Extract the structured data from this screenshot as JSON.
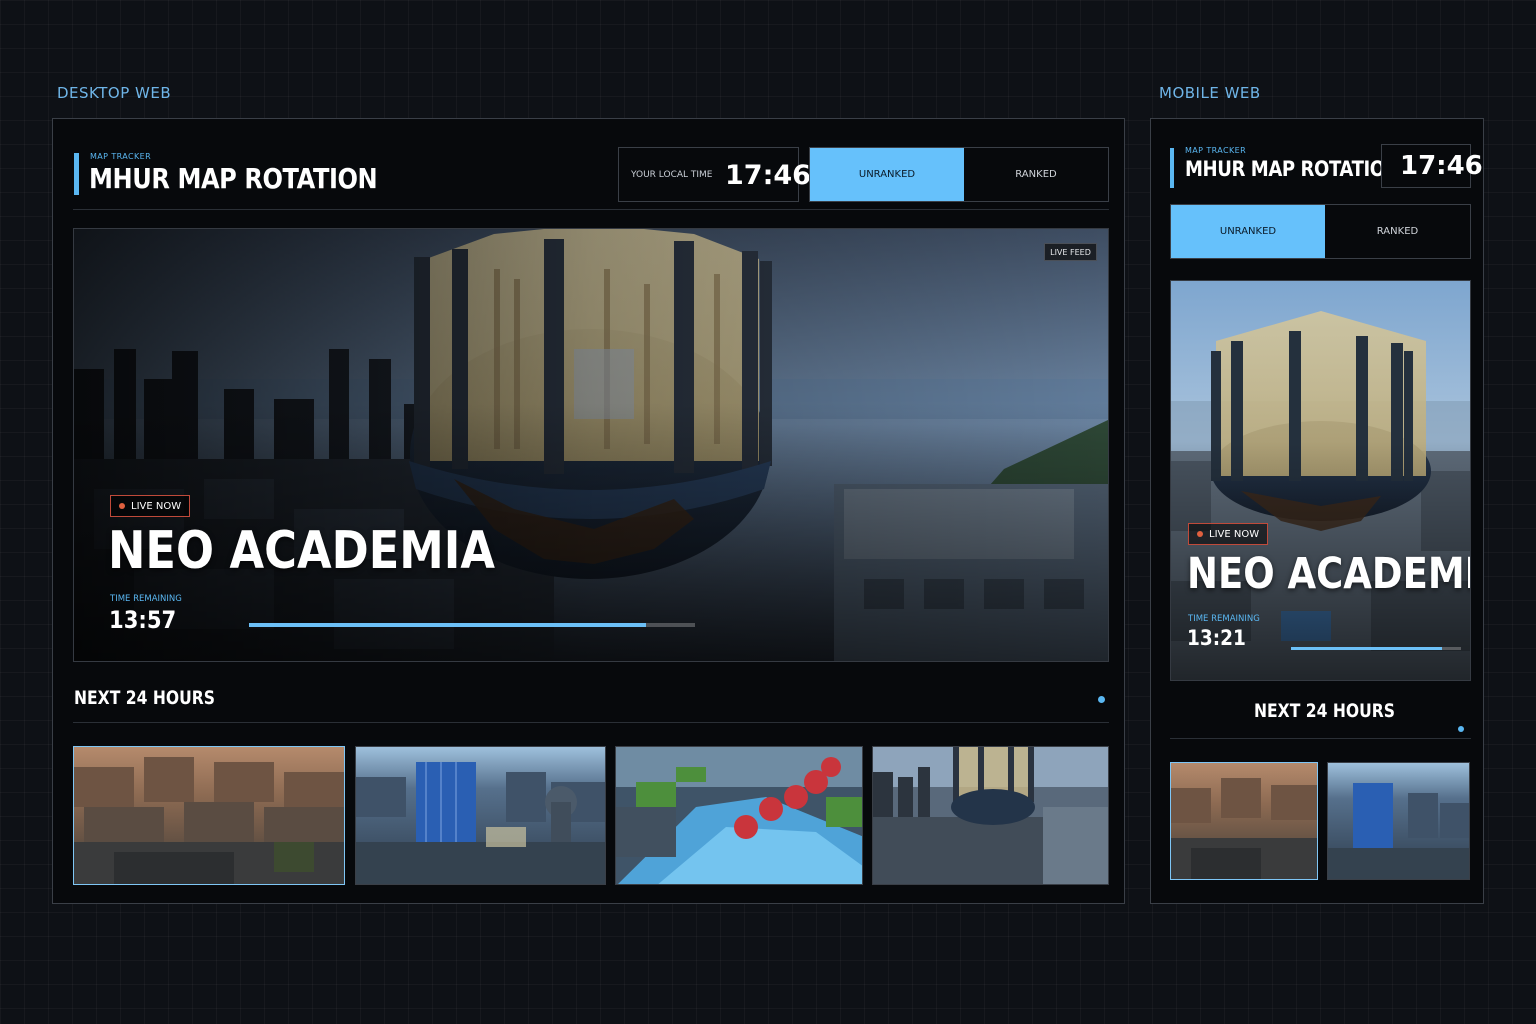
{
  "captions": {
    "desktop": "DESKTOP WEB",
    "mobile": "MOBILE WEB"
  },
  "desktop": {
    "header": {
      "eyebrow": "MAP TRACKER",
      "title": "MHUR MAP ROTATION"
    },
    "clock": {
      "label": "YOUR LOCAL TIME",
      "time": "17:46"
    },
    "tabs": [
      {
        "label": "UNRANKED",
        "active": true
      },
      {
        "label": "RANKED",
        "active": false
      }
    ],
    "hero": {
      "badge": "LIVE NOW",
      "map_name": "NEO ACADEMIA",
      "time_label": "TIME REMAINING",
      "time_value": "13:57",
      "progress": 0.89,
      "live_feed": "LIVE FEED"
    },
    "next": {
      "title": "NEXT 24 HOURS"
    },
    "thumbnails": [
      {
        "scene": "desert-city",
        "selected": true
      },
      {
        "scene": "blue-tower-city",
        "selected": false
      },
      {
        "scene": "water-park",
        "selected": false
      },
      {
        "scene": "neo-academia",
        "selected": false
      }
    ]
  },
  "mobile": {
    "header": {
      "eyebrow": "MAP TRACKER",
      "title": "MHUR MAP ROTATION"
    },
    "clock": {
      "time": "17:46"
    },
    "tabs": [
      {
        "label": "UNRANKED",
        "active": true
      },
      {
        "label": "RANKED",
        "active": false
      }
    ],
    "hero": {
      "badge": "LIVE NOW",
      "map_name": "NEO ACADEMIA",
      "time_label": "TIME REMAINING",
      "time_value": "13:21",
      "progress": 0.89
    },
    "next": {
      "title": "NEXT 24 HOURS"
    },
    "thumbnails": [
      {
        "scene": "desert-city",
        "selected": true
      },
      {
        "scene": "blue-tower-city",
        "selected": false
      }
    ]
  },
  "colors": {
    "accent": "#66c1fb",
    "live": "#e0603f",
    "background": "#0e1116"
  }
}
